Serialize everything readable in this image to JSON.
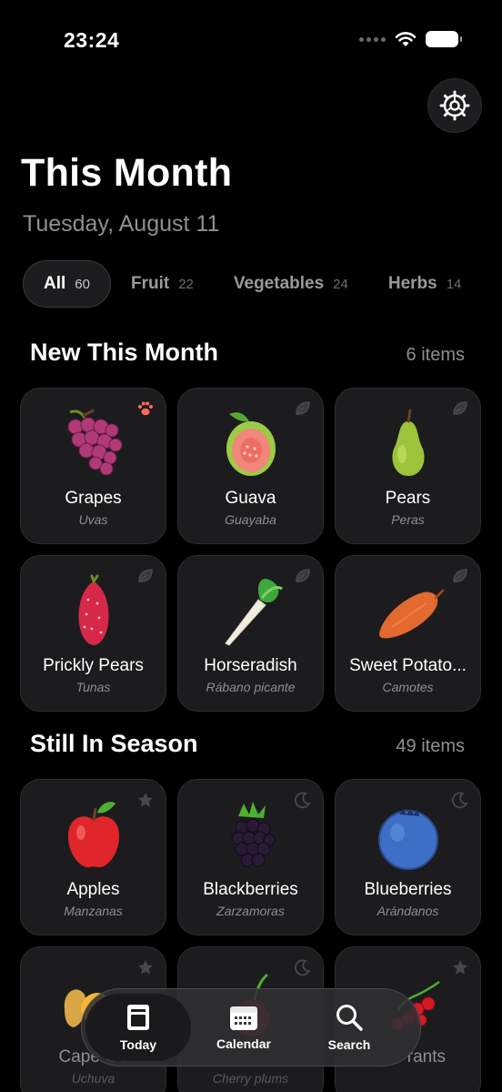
{
  "status": {
    "time": "23:24"
  },
  "header": {
    "title": "This Month",
    "date": "Tuesday, August 11"
  },
  "filters": [
    {
      "label": "All",
      "count": "60"
    },
    {
      "label": "Fruit",
      "count": "22"
    },
    {
      "label": "Vegetables",
      "count": "24"
    },
    {
      "label": "Herbs",
      "count": "14"
    }
  ],
  "sections": {
    "new": {
      "title": "New This Month",
      "count": "6 items",
      "items": [
        {
          "name": "Grapes",
          "sub": "Uvas",
          "icon": "grapes-icon",
          "badge": "paw-icon"
        },
        {
          "name": "Guava",
          "sub": "Guayaba",
          "icon": "guava-icon",
          "badge": "leaf-icon"
        },
        {
          "name": "Pears",
          "sub": "Peras",
          "icon": "pear-icon",
          "badge": "leaf-icon"
        },
        {
          "name": "Prickly Pears",
          "sub": "Tunas",
          "icon": "prickly-pear-icon",
          "badge": "leaf-icon"
        },
        {
          "name": "Horseradish",
          "sub": "Rábano picante",
          "icon": "horseradish-icon",
          "badge": "leaf-icon"
        },
        {
          "name": "Sweet Potato...",
          "sub": "Camotes",
          "icon": "sweet-potato-icon",
          "badge": "leaf-icon"
        }
      ]
    },
    "still": {
      "title": "Still In Season",
      "count": "49 items",
      "items": [
        {
          "name": "Apples",
          "sub": "Manzanas",
          "icon": "apple-icon",
          "badge": "star-icon"
        },
        {
          "name": "Blackberries",
          "sub": "Zarzamoras",
          "icon": "blackberry-icon",
          "badge": "moon-icon"
        },
        {
          "name": "Blueberries",
          "sub": "Arándanos",
          "icon": "blueberry-icon",
          "badge": "moon-icon"
        },
        {
          "name": "Cape Go",
          "sub": "Uchuva",
          "icon": "cape-gooseberry-icon",
          "badge": "star-icon"
        },
        {
          "name": "",
          "sub": "Cherry plums",
          "icon": "cherry-plum-icon",
          "badge": "moon-icon"
        },
        {
          "name": "rants",
          "sub": "",
          "icon": "currants-icon",
          "badge": "star-icon"
        }
      ]
    }
  },
  "tabbar": {
    "today": "Today",
    "calendar": "Calendar",
    "search": "Search"
  },
  "colors": {
    "background": "#000000",
    "card": "#1c1c1e",
    "muted": "#8e8e93",
    "paw": "#ff6b5a"
  }
}
